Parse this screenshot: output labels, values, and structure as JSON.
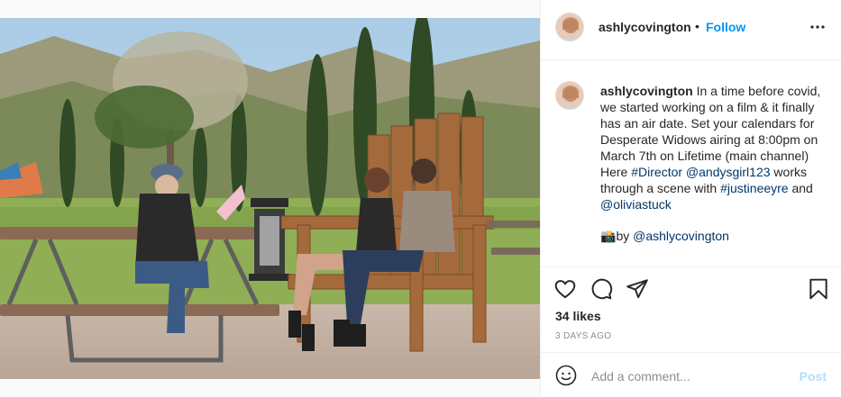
{
  "post": {
    "image_alt": "Three women rehearsing a scene at a picnic table and a large wooden chair outdoors"
  },
  "header": {
    "username": "ashlycovington",
    "separator": "•",
    "follow_label": "Follow"
  },
  "caption": {
    "username": "ashlycovington",
    "text_1": " In a time before covid, we started working on a film & it finally has an air date. Set your calendars for Desperate Widows airing at 8:00pm on March 7th on Lifetime (main channel) Here ",
    "tag_director": "#Director",
    "text_2": " ",
    "tag_andysgirl": "@andysgirl123",
    "text_3": " works through a scene with ",
    "tag_justine": "#justineeyre",
    "text_4": " and ",
    "tag_olivia": "@oliviastuck",
    "credit_emoji": "📸",
    "credit_by": "by ",
    "credit_user": "@ashlycovington"
  },
  "stats": {
    "likes": "34 likes",
    "date": "3 DAYS AGO"
  },
  "comment": {
    "placeholder": "Add a comment...",
    "post_label": "Post"
  },
  "colors": {
    "link": "#0095f6",
    "tag": "#00376b",
    "muted": "#8e8e8e"
  }
}
